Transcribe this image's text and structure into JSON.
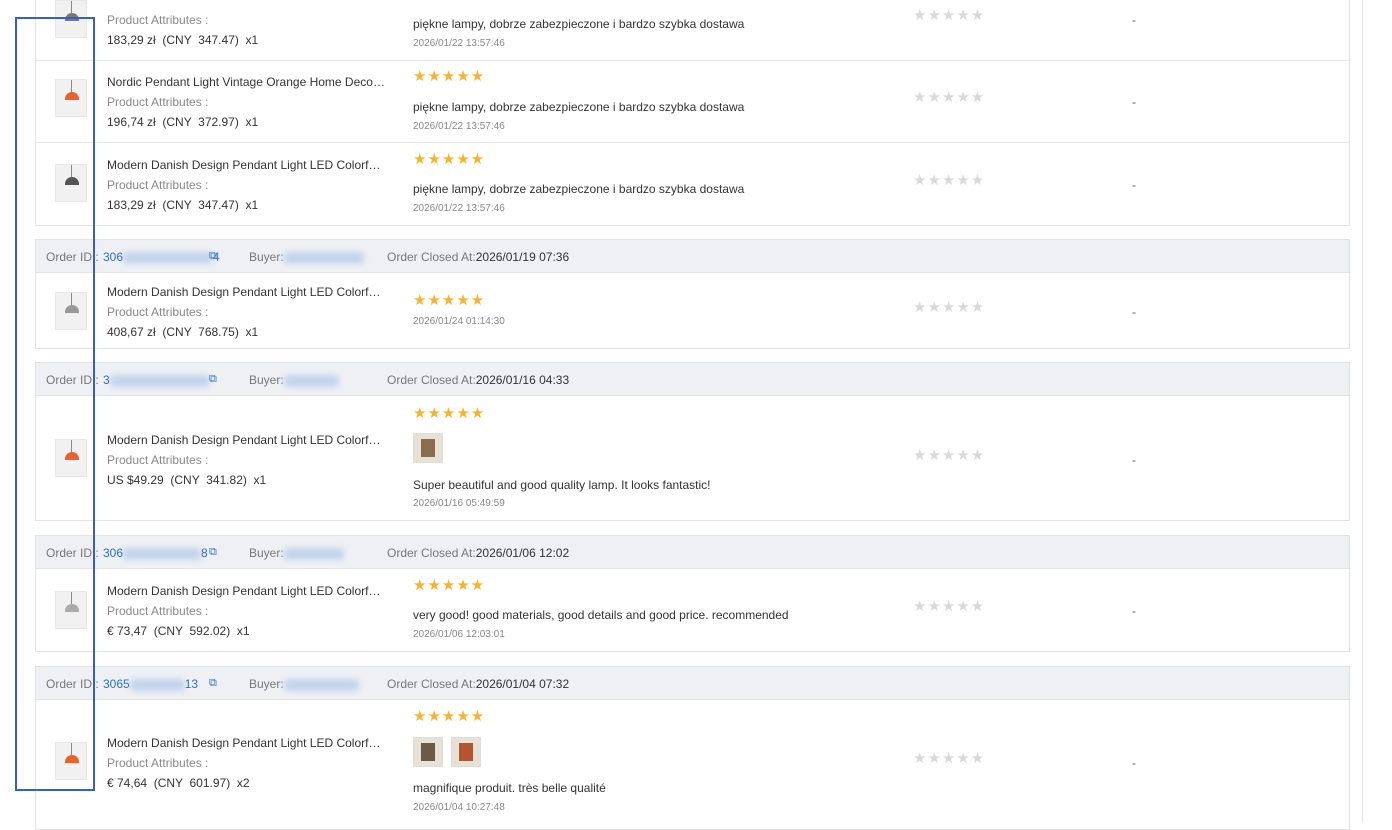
{
  "labels": {
    "product_attributes": "Product Attributes :",
    "order_id": "Order ID :",
    "buyer": "Buyer:",
    "order_closed_at": "Order Closed At:"
  },
  "placeholder_dash": "-",
  "star_glyphs": "★★★★★",
  "colors": {
    "star_active": "#f7b32b",
    "star_inactive": "#d9d9d9",
    "link": "#2d6fc8",
    "highlight_box": "#3a5fbf"
  },
  "rows_top": [
    {
      "title": "",
      "price": "183,29 zł  (CNY  347.47)  x1",
      "review": "piękne lampy, dobrze zabezpieczone i bardzo szybka dostawa",
      "date": "2026/01/22 13:57:46"
    },
    {
      "title": "Nordic Pendant Light Vintage Orange Home Decora...",
      "price": "196,74 zł  (CNY  372.97)  x1",
      "review": "piękne lampy, dobrze zabezpieczone i bardzo szybka dostawa",
      "date": "2026/01/22 13:57:46"
    },
    {
      "title": "Modern Danish Design Pendant Light LED Colorful ...",
      "price": "183,29 zł  (CNY  347.47)  x1",
      "review": "piękne lampy, dobrze zabezpieczone i bardzo szybka dostawa",
      "date": "2026/01/22 13:57:46"
    }
  ],
  "orders": [
    {
      "id_prefix": "306",
      "id_suffix": "4",
      "buyer": "",
      "closed_at": "2026/01/19 07:36",
      "item": {
        "title": "Modern Danish Design Pendant Light LED Colorful ...",
        "price": "408,67 zł  (CNY  768.75)  x1",
        "review": "",
        "date": "2026/01/24 01:14:30"
      }
    },
    {
      "id_prefix": "3",
      "id_suffix": "",
      "buyer": "",
      "closed_at": "2026/01/16 04:33",
      "item": {
        "title": "Modern Danish Design Pendant Light LED Colorful ...",
        "price": "US $49.29  (CNY  341.82)  x1",
        "review": "Super beautiful and good quality lamp. It looks fantastic!",
        "date": "2026/01/16 05:49:59"
      }
    },
    {
      "id_prefix": "306",
      "id_suffix": "8",
      "buyer": "",
      "closed_at": "2026/01/06 12:02",
      "item": {
        "title": "Modern Danish Design Pendant Light LED Colorful ...",
        "price": "€ 73,47  (CNY  592.02)  x1",
        "review": "very good! good materials, good details and good price. recommended",
        "date": "2026/01/06 12:03:01"
      }
    },
    {
      "id_prefix": "3065",
      "id_suffix": "13",
      "buyer": "",
      "closed_at": "2026/01/04 07:32",
      "item": {
        "title": "Modern Danish Design Pendant Light LED Colorful ...",
        "price": "€ 74,64  (CNY  601.97)  x2",
        "review": "magnifique produit. très belle qualité",
        "date": "2026/01/04 10:27:48"
      }
    }
  ]
}
